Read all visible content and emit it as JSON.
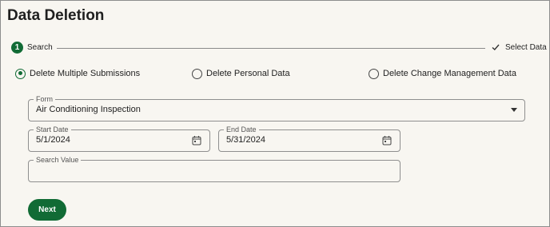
{
  "page": {
    "title": "Data Deletion"
  },
  "stepper": {
    "steps": [
      {
        "number": "1",
        "label": "Search",
        "state": "active"
      },
      {
        "label": "Select Data",
        "state": "pending",
        "icon": "check-icon"
      }
    ],
    "accent": "#116b35"
  },
  "delete_type": {
    "options": [
      {
        "label": "Delete Multiple Submissions",
        "selected": true
      },
      {
        "label": "Delete Personal Data",
        "selected": false
      },
      {
        "label": "Delete Change Management Data",
        "selected": false
      }
    ]
  },
  "form_fields": {
    "form": {
      "label": "Form",
      "value": "Air Conditioning Inspection"
    },
    "start_date": {
      "label": "Start Date",
      "value": "5/1/2024",
      "icon": "calendar-icon"
    },
    "end_date": {
      "label": "End Date",
      "value": "5/31/2024",
      "icon": "calendar-icon"
    },
    "search_value": {
      "label": "Search Value",
      "value": ""
    }
  },
  "actions": {
    "next_label": "Next"
  }
}
